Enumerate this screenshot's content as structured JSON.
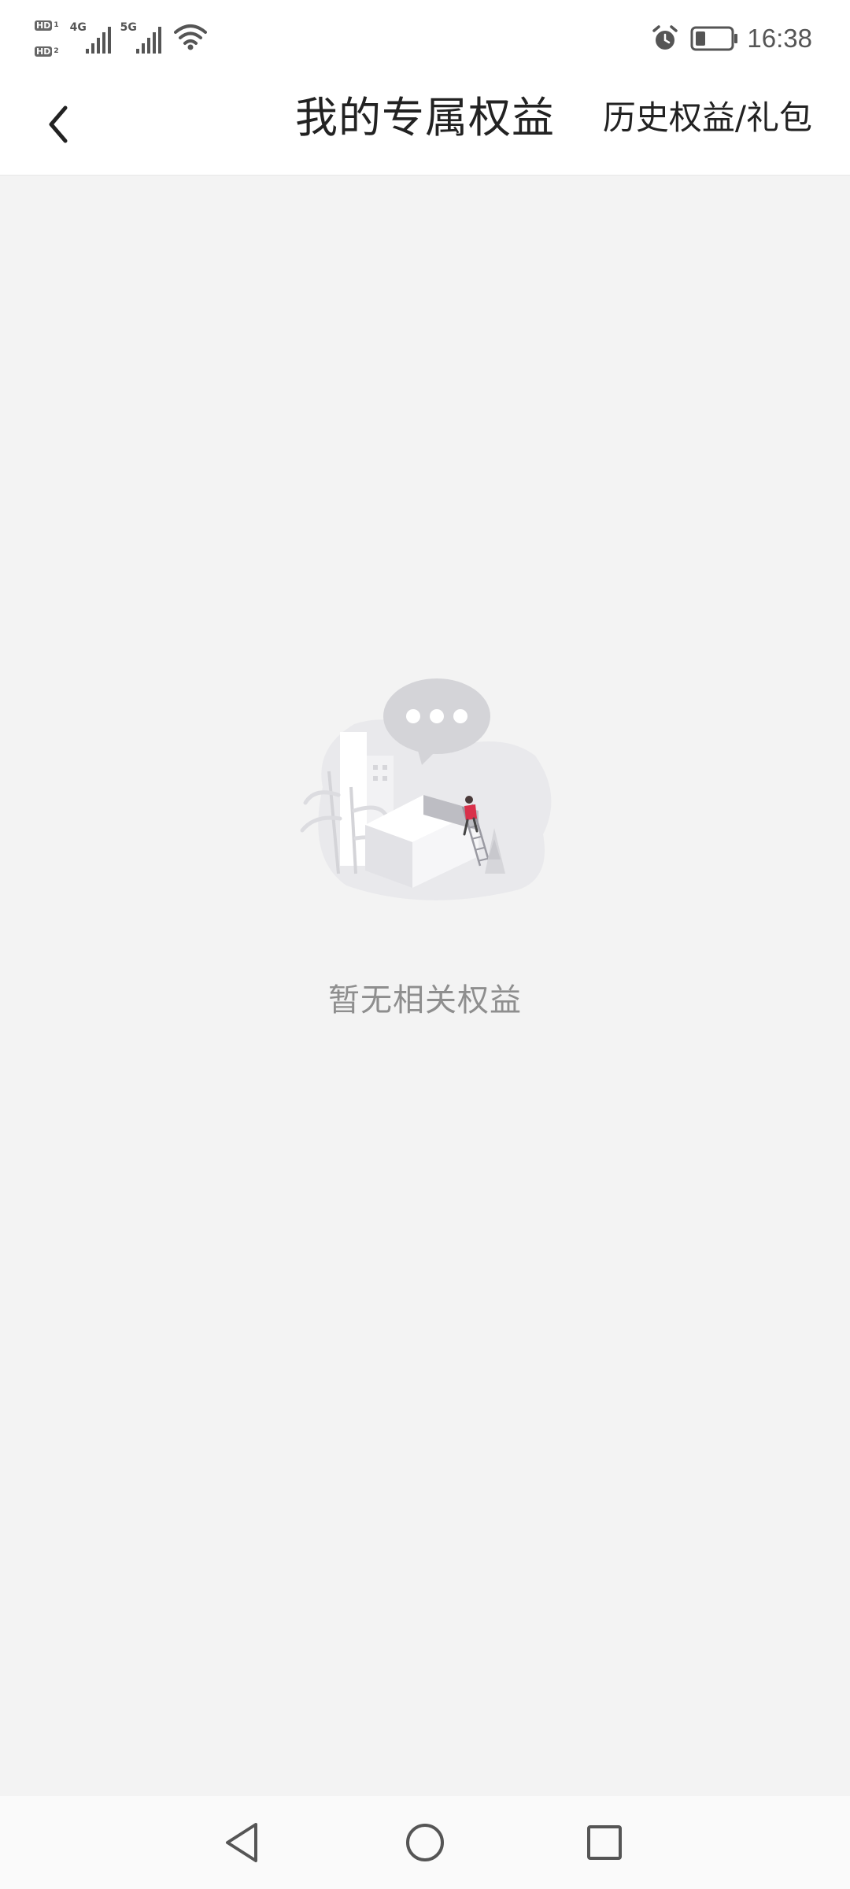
{
  "status_bar": {
    "sim1_label": "HD",
    "sim1_index": "1",
    "sim2_label": "HD",
    "sim2_index": "2",
    "network1": "4G",
    "network2": "5G",
    "time": "16:38",
    "icons": [
      "hd-icon",
      "signal-icon",
      "wifi-icon",
      "alarm-icon",
      "battery-icon"
    ]
  },
  "header": {
    "title": "我的专属权益",
    "history_link": "历史权益/礼包",
    "back_icon": "back-chevron-icon"
  },
  "empty_state": {
    "illustration": "empty-illustration",
    "message": "暂无相关权益"
  },
  "nav_bar": {
    "icons": [
      "nav-back-icon",
      "nav-home-icon",
      "nav-recents-icon"
    ]
  },
  "colors": {
    "background": "#f3f3f3",
    "header_bg": "#ffffff",
    "title_text": "#222222",
    "empty_text": "#8e8e8e",
    "accent_figure": "#d9304a"
  }
}
